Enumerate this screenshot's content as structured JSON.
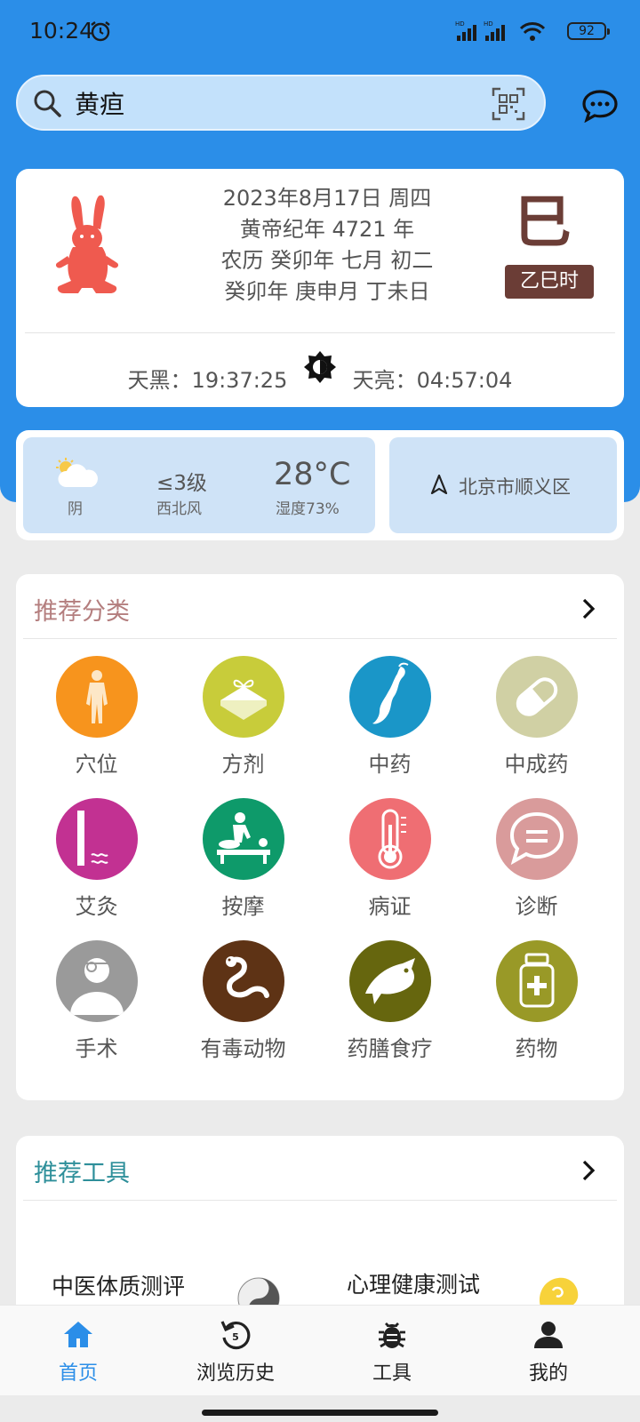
{
  "status_bar": {
    "time": "10:24",
    "battery": "92"
  },
  "search": {
    "value": "黄疸"
  },
  "calendar": {
    "line1": "2023年8月17日 周四",
    "line2": "黄帝纪年 4721 年",
    "line3": "农历 癸卯年 七月 初二",
    "line4": "癸卯年 庚申月 丁未日",
    "hour_glyph": "巳",
    "hour_badge": "乙巳时",
    "dusk": "天黑：19:37:25",
    "dawn": "天亮：04:57:04"
  },
  "weather": {
    "condition": "阴",
    "wind_level": "≤3级",
    "wind_dir": "西北风",
    "temperature": "28°C",
    "humidity": "湿度73%",
    "location": "北京市顺义区"
  },
  "categories": {
    "title": "推荐分类",
    "title_color": "#b47e7e",
    "items": [
      {
        "label": "穴位",
        "icon": "human-body-icon",
        "color": "#f7941d"
      },
      {
        "label": "方剂",
        "icon": "herb-package-icon",
        "color": "#c8cc3a"
      },
      {
        "label": "中药",
        "icon": "ginseng-root-icon",
        "color": "#1a96c8"
      },
      {
        "label": "中成药",
        "icon": "capsule-icon",
        "color": "#d0d0a4"
      },
      {
        "label": "艾灸",
        "icon": "moxa-stick-icon",
        "color": "#c23192"
      },
      {
        "label": "按摩",
        "icon": "massage-icon",
        "color": "#0e9a6a"
      },
      {
        "label": "病证",
        "icon": "thermometer-icon",
        "color": "#ef6e73"
      },
      {
        "label": "诊断",
        "icon": "speech-bubble-icon",
        "color": "#d99b9b"
      },
      {
        "label": "手术",
        "icon": "surgeon-icon",
        "color": "#9a9a9a"
      },
      {
        "label": "有毒动物",
        "icon": "snake-icon",
        "color": "#5e3315"
      },
      {
        "label": "药膳食疗",
        "icon": "fish-icon",
        "color": "#66660e"
      },
      {
        "label": "药物",
        "icon": "medicine-bottle-icon",
        "color": "#999927"
      }
    ]
  },
  "tools": {
    "title": "推荐工具",
    "title_color": "#2e8f9a",
    "items": [
      {
        "label": "中医体质测评",
        "icon": "yin-yang-icon"
      },
      {
        "label": "心理健康测试",
        "icon": "brain-head-icon"
      }
    ]
  },
  "bottom_nav": [
    {
      "label": "首页",
      "icon": "home-icon",
      "active": true
    },
    {
      "label": "浏览历史",
      "icon": "history-icon",
      "badge": "5"
    },
    {
      "label": "工具",
      "icon": "bug-icon"
    },
    {
      "label": "我的",
      "icon": "person-icon"
    }
  ],
  "colors": {
    "primary": "#2b8ee8",
    "hour_badge_bg": "#6b3d36",
    "rabbit": "#ef5a4f"
  }
}
